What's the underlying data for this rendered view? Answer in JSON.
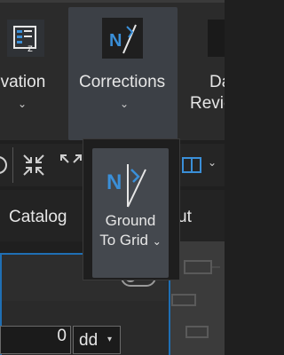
{
  "ribbon": {
    "elevation": {
      "label": "evation",
      "chevron": "⌄",
      "icon": "elevation-layers-icon"
    },
    "corrections": {
      "label": "Corrections",
      "chevron": "⌄",
      "icon": "corrections-icon"
    },
    "data_reviewer": {
      "label1": "Da",
      "label2": "Revie",
      "icon": "data-reviewer-icon"
    }
  },
  "toolbar": {
    "icons": [
      "globe-icon",
      "collapse-arrows-icon",
      "expand-arrows-icon",
      "book-icon"
    ],
    "book_chevron": "⌄"
  },
  "tabs": {
    "catalog": "Catalog",
    "layout_fragment": "ut"
  },
  "gallery": {
    "item_label1": "Ground",
    "item_label2": "To Grid",
    "chevron": "⌄",
    "icon": "ground-to-grid-icon"
  },
  "panel": {
    "value": "0",
    "unit": "dd",
    "unit_arrow": "▾",
    "toggle_state": "off"
  },
  "colors": {
    "accent_blue": "#1f6fb4",
    "icon_blue": "#3a8fd8",
    "selected_bg": "#3c4046"
  }
}
